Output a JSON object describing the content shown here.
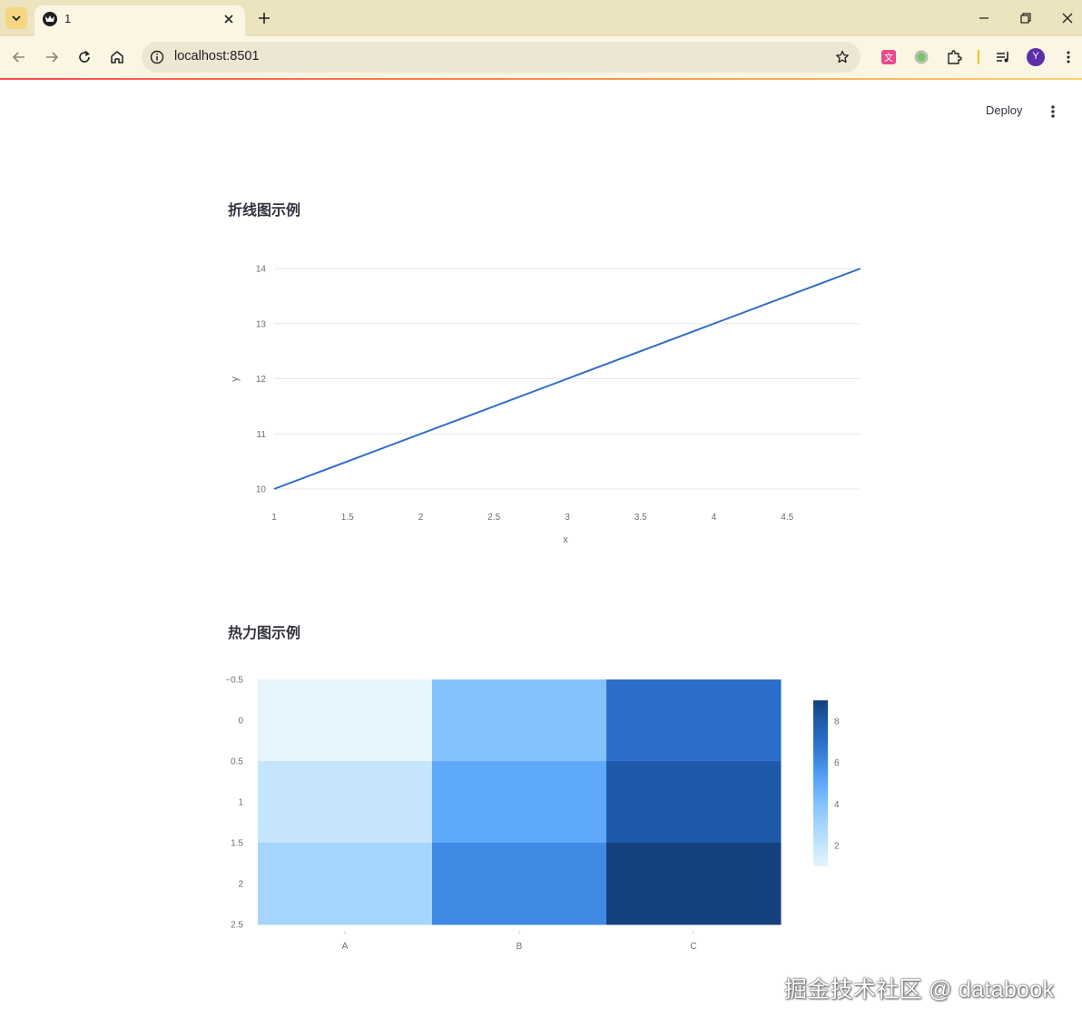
{
  "browser": {
    "tab_title": "1",
    "url": "localhost:8501",
    "profile_initial": "Y"
  },
  "app": {
    "deploy_label": "Deploy"
  },
  "line_section": {
    "title": "折线图示例"
  },
  "heatmap_section": {
    "title": "热力图示例"
  },
  "watermark": "掘金技术社区 @ databook",
  "colors": {
    "line": "#2e6cc7",
    "heat_scale": [
      "#e6f4fd",
      "#c4e5fc",
      "#a5d5fd",
      "#84c2fd",
      "#5ea9fb",
      "#3f8ae4",
      "#2b6fca",
      "#1e5aa9",
      "#15417e"
    ]
  },
  "chart_data": [
    {
      "type": "line",
      "title": "",
      "xlabel": "x",
      "ylabel": "y",
      "series": [
        {
          "x": [
            1,
            2,
            3,
            4,
            5
          ],
          "y": [
            10,
            11,
            12,
            13,
            14
          ]
        }
      ],
      "xlim": [
        1,
        5
      ],
      "ylim": [
        10,
        14
      ],
      "xticks": [
        "1",
        "1.5",
        "2",
        "2.5",
        "3",
        "3.5",
        "4",
        "4.5"
      ],
      "yticks": [
        "10",
        "11",
        "12",
        "13",
        "14"
      ],
      "grid": true
    },
    {
      "type": "heatmap",
      "title": "",
      "xcategories": [
        "A",
        "B",
        "C"
      ],
      "yticks": [
        "−0.5",
        "0",
        "0.5",
        "1",
        "1.5",
        "2",
        "2.5"
      ],
      "values": [
        [
          1,
          4,
          7
        ],
        [
          2,
          5,
          8
        ],
        [
          3,
          6,
          9
        ]
      ],
      "colorbar": {
        "ticks": [
          "2",
          "4",
          "6",
          "8"
        ],
        "range": [
          1,
          9
        ]
      }
    }
  ]
}
